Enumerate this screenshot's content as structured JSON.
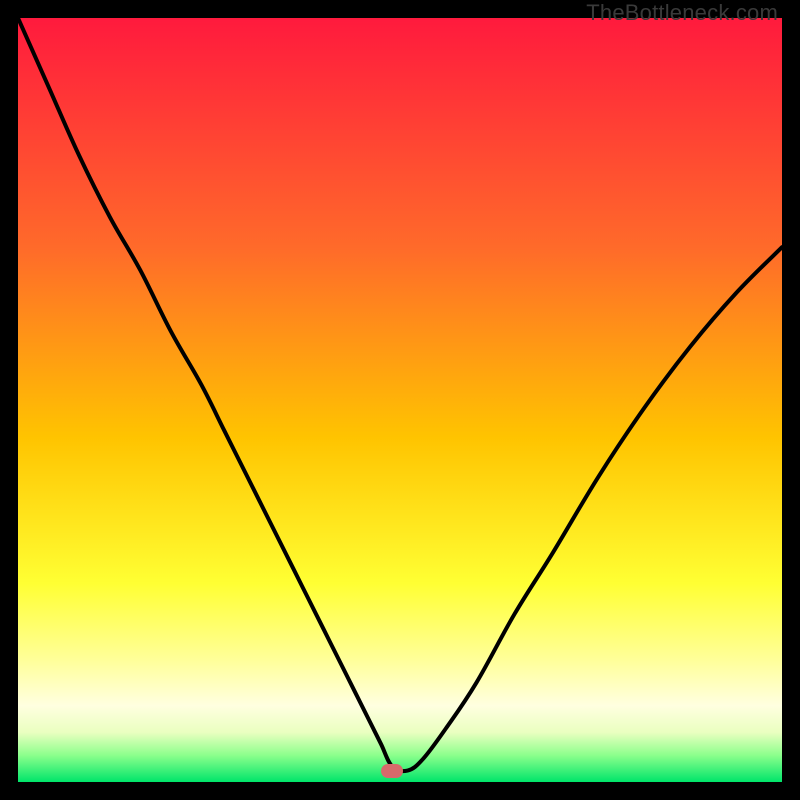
{
  "watermark": "TheBottleneck.com",
  "colors": {
    "top": "#ff1a3d",
    "mid_upper": "#ff7a2a",
    "mid": "#ffd400",
    "mid_lower": "#ffff66",
    "pale_yellow": "#ffffcc",
    "green": "#00e56a",
    "curve": "#000000",
    "marker": "#d76a6b",
    "frame": "#000000"
  },
  "chart_data": {
    "type": "line",
    "title": "",
    "xlabel": "",
    "ylabel": "",
    "xlim": [
      0,
      100
    ],
    "ylim": [
      0,
      100
    ],
    "grid": false,
    "note": "Axes are unlabeled in the image; values are estimated from pixel positions as percent of plot width/height (0 at left/bottom, 100 at right/top).",
    "series": [
      {
        "name": "curve",
        "x": [
          0,
          4,
          8,
          12,
          16,
          20,
          24,
          27,
          30,
          33,
          36,
          38,
          40,
          42,
          44,
          46,
          47.5,
          49,
          51,
          53,
          56,
          60,
          65,
          70,
          76,
          82,
          88,
          94,
          100
        ],
        "y": [
          100,
          91,
          82,
          74,
          67,
          59,
          52,
          46,
          40,
          34,
          28,
          24,
          20,
          16,
          12,
          8,
          5,
          2,
          1.5,
          3,
          7,
          13,
          22,
          30,
          40,
          49,
          57,
          64,
          70
        ]
      }
    ],
    "marker": {
      "x": 49,
      "y": 1.5
    },
    "background_gradient_stops": [
      {
        "pos": 0.0,
        "color": "#ff1a3d"
      },
      {
        "pos": 0.3,
        "color": "#ff6a2a"
      },
      {
        "pos": 0.55,
        "color": "#ffc400"
      },
      {
        "pos": 0.74,
        "color": "#ffff33"
      },
      {
        "pos": 0.84,
        "color": "#ffff99"
      },
      {
        "pos": 0.9,
        "color": "#ffffe0"
      },
      {
        "pos": 0.935,
        "color": "#eaffc0"
      },
      {
        "pos": 0.965,
        "color": "#8cff8c"
      },
      {
        "pos": 1.0,
        "color": "#00e56a"
      }
    ]
  }
}
